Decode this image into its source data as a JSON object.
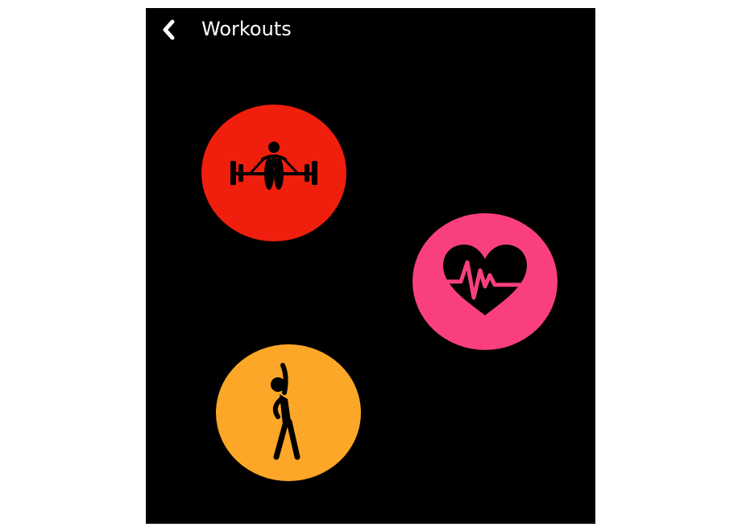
{
  "header": {
    "title": "Workouts",
    "back_icon": "chevron-left-icon"
  },
  "workouts": [
    {
      "id": "strength",
      "icon": "weightlifting-icon",
      "color": "#f01e0d"
    },
    {
      "id": "cardio",
      "icon": "heart-rate-icon",
      "color": "#fa407c"
    },
    {
      "id": "flexibility",
      "icon": "stretching-icon",
      "color": "#fca728"
    }
  ],
  "colors": {
    "background": "#000000",
    "text": "#ffffff",
    "icon_glyph": "#000000"
  }
}
